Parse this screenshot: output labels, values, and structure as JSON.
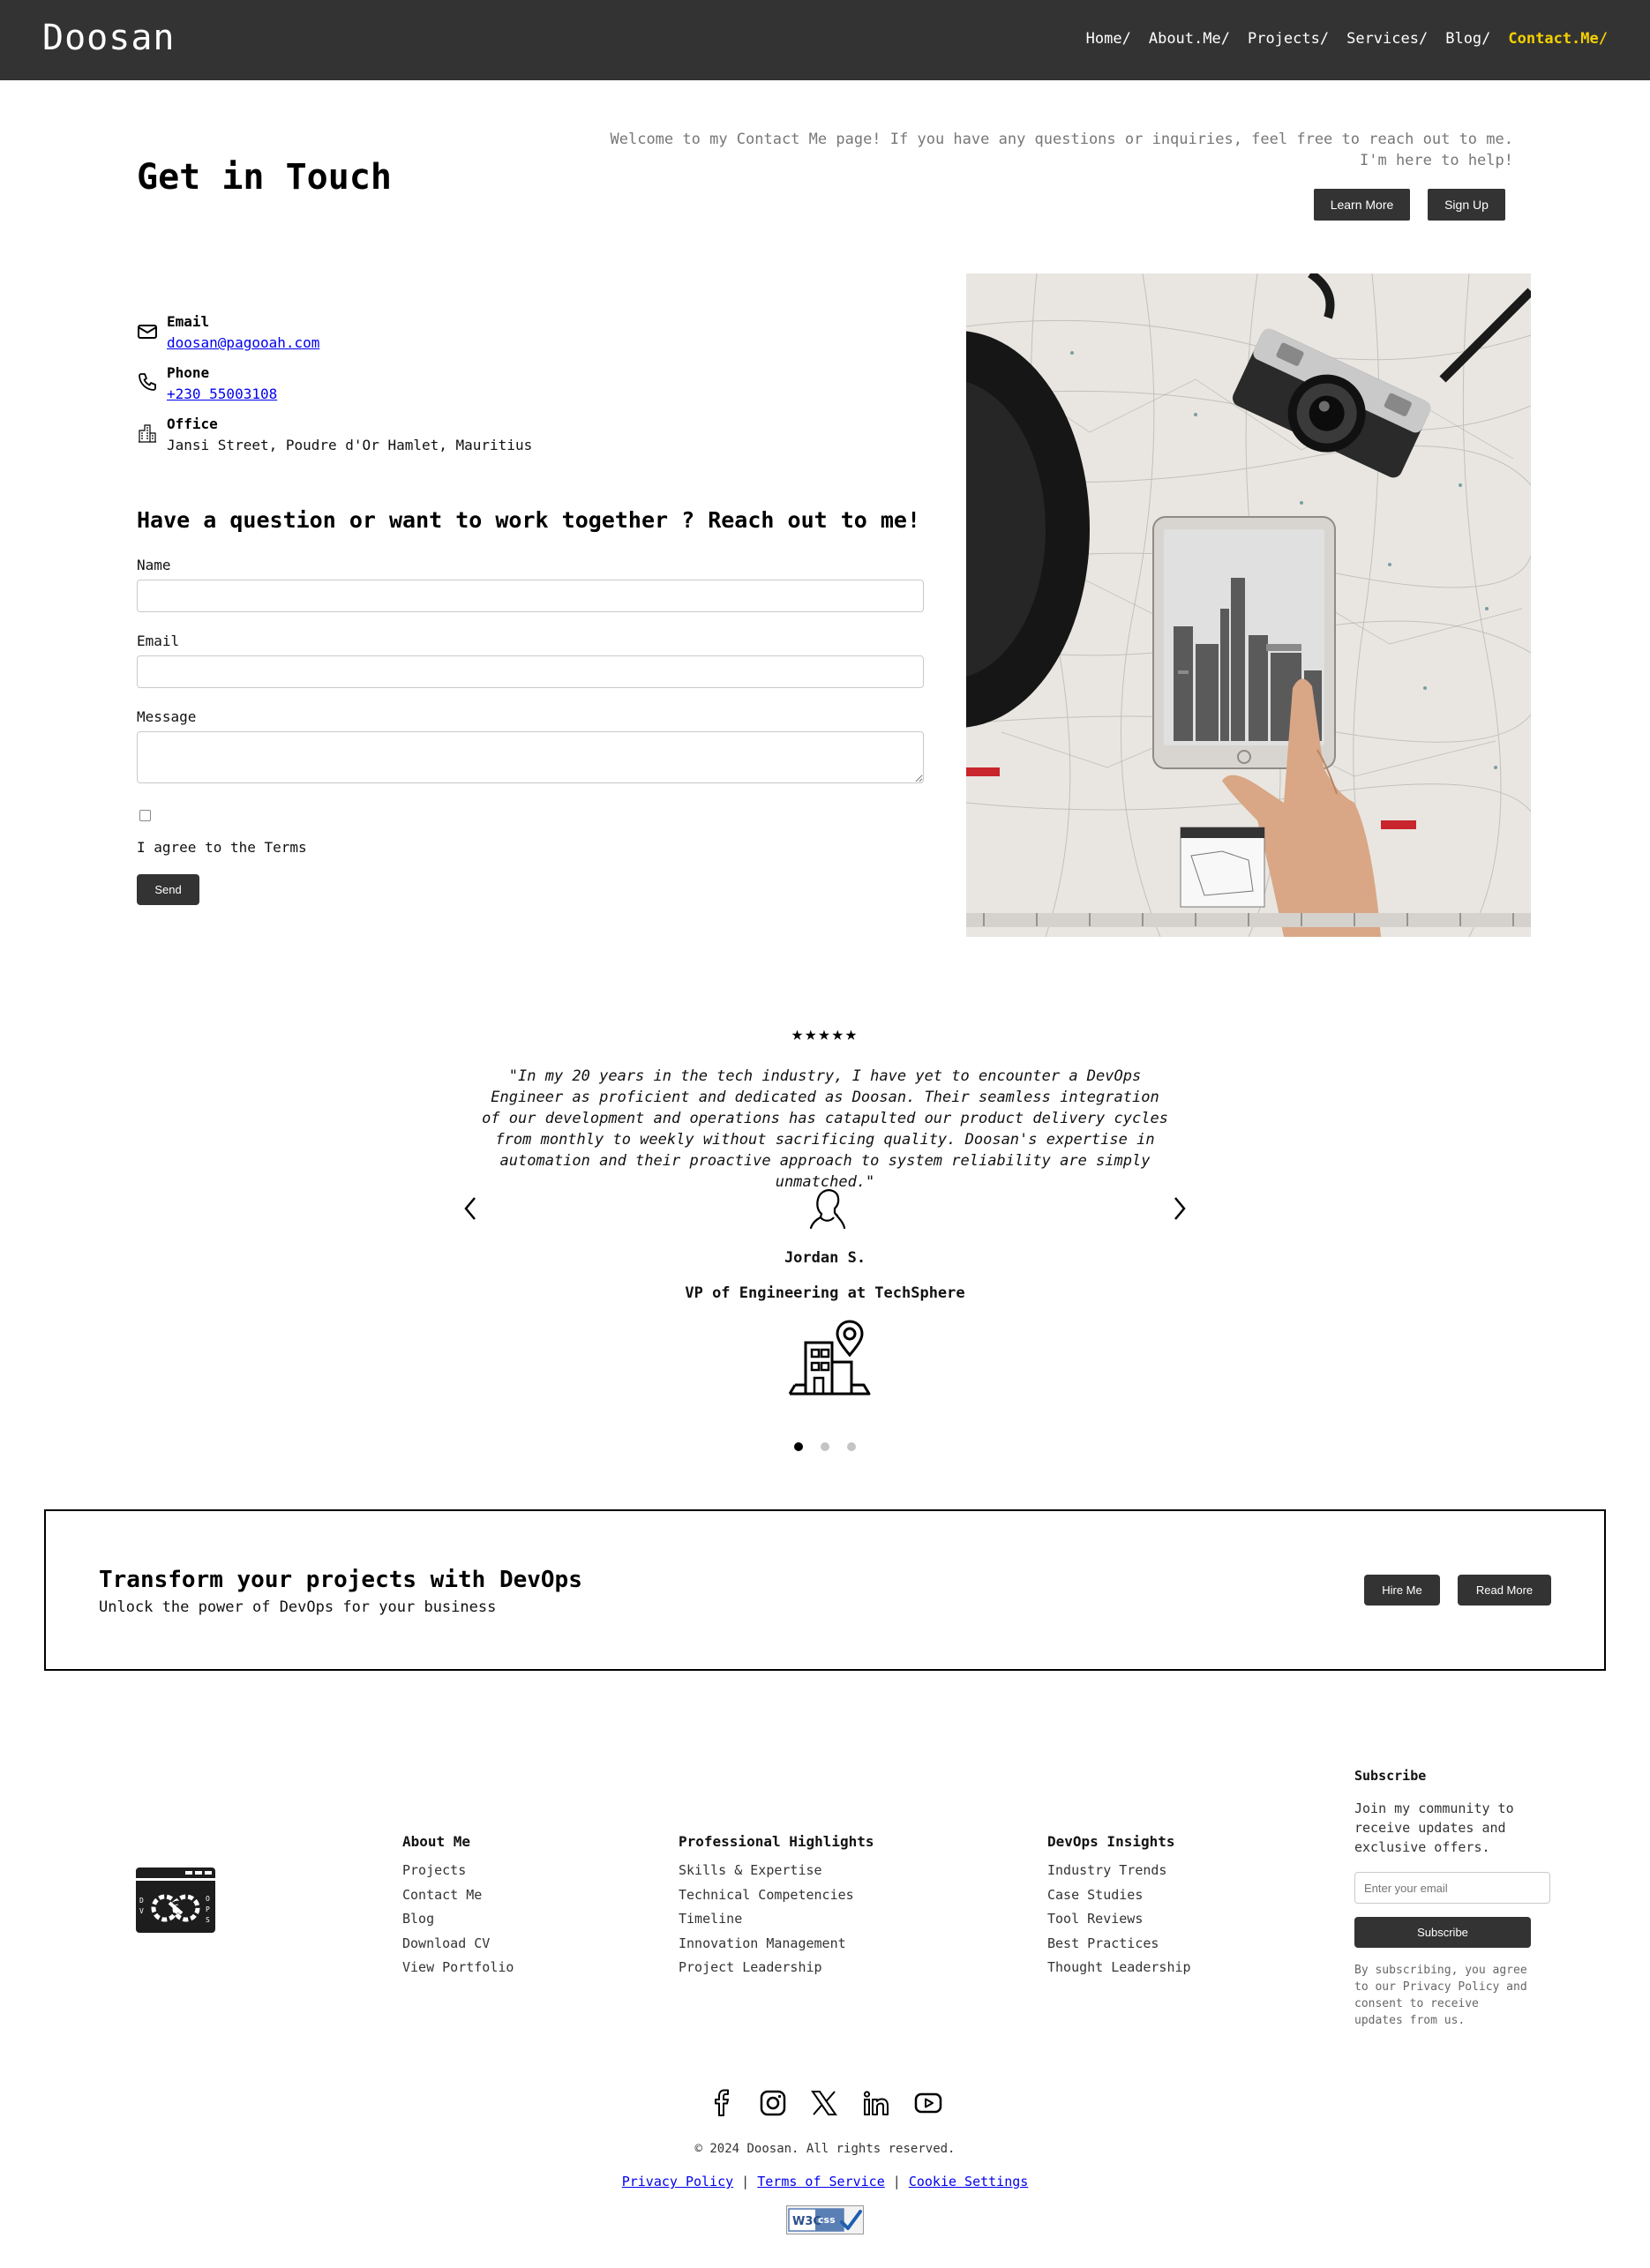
{
  "nav": {
    "logo": "Doosan",
    "links": [
      {
        "label": "Home/"
      },
      {
        "label": "About.Me/"
      },
      {
        "label": "Projects/"
      },
      {
        "label": "Services/"
      },
      {
        "label": "Blog/"
      },
      {
        "label": "Contact.Me/",
        "active": true
      }
    ],
    "active_color": "#f5d000",
    "background": "#333333"
  },
  "hero": {
    "title": "Get in Touch",
    "text": "Welcome to my Contact Me page! If you have any questions or inquiries, feel free to reach out to me. I'm here to help!",
    "learn_more": "Learn More",
    "sign_up": "Sign Up"
  },
  "contact": {
    "email_label": "Email",
    "email_value": "doosan@pagooah.com",
    "phone_label": "Phone",
    "phone_value": "+230 55003108",
    "office_label": "Office",
    "office_value": "Jansi Street, Poudre d'Or Hamlet, Mauritius",
    "icons": [
      "envelope-icon",
      "phone-icon",
      "building-icon"
    ]
  },
  "form": {
    "heading": "Have a question or want to work together ? Reach out to me!",
    "name_label": "Name",
    "name_value": "",
    "email_label": "Email",
    "email_value": "",
    "message_label": "Message",
    "message_value": "",
    "terms_label": "I agree to the Terms",
    "terms_checked": false,
    "send": "Send"
  },
  "testimonial": {
    "stars": "★★★★★",
    "quote": "\"In my 20 years in the tech industry, I have yet to encounter a DevOps Engineer as proficient and dedicated as Doosan. Their seamless integration of our development and operations has catapulted our product delivery cycles from monthly to weekly without sacrificing quality. Doosan's expertise in automation and their proactive approach to system reliability are simply unmatched.\"",
    "name": "Jordan S.",
    "role": "VP of Engineering at TechSphere",
    "slide_count": 3,
    "active_slide": 1
  },
  "cta": {
    "title": "Transform your projects with DevOps",
    "subtitle": "Unlock the power of DevOps for your business",
    "hire": "Hire Me",
    "read": "Read More"
  },
  "footer": {
    "col1": {
      "heading": "About Me",
      "links": [
        "Projects",
        "Contact Me",
        "Blog",
        "Download CV",
        "View Portfolio"
      ]
    },
    "col2": {
      "heading": "Professional Highlights",
      "links": [
        "Skills & Expertise",
        "Technical Competencies",
        "Timeline",
        "Innovation Management",
        "Project Leadership"
      ]
    },
    "col3": {
      "heading": "DevOps Insights",
      "links": [
        "Industry Trends",
        "Case Studies",
        "Tool Reviews",
        "Best Practices",
        "Thought Leadership"
      ]
    },
    "subscribe": {
      "heading": "Subscribe",
      "text": "Join my community to receive updates and exclusive offers.",
      "placeholder": "Enter your email",
      "button": "Subscribe",
      "fine": "By subscribing, you agree to our Privacy Policy and consent to receive updates from us."
    },
    "social": [
      "facebook-icon",
      "instagram-icon",
      "x-icon",
      "linkedin-icon",
      "youtube-icon"
    ],
    "copyright": "© 2024 Doosan. All rights reserved.",
    "privacy": "Privacy Policy",
    "terms": "Terms of Service",
    "cookies": "Cookie Settings",
    "separator": "|",
    "badge_text": "W3C css"
  }
}
